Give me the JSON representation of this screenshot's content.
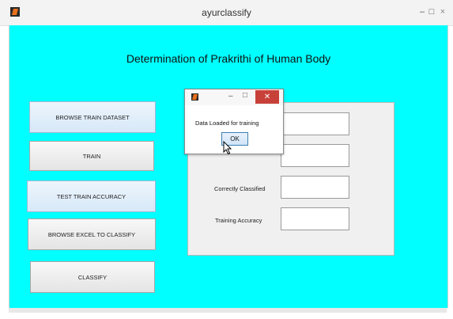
{
  "window": {
    "title": "ayurclassify",
    "min_glyph": "–",
    "max_glyph": "□",
    "close_glyph": "×"
  },
  "main": {
    "heading": "Determination of Prakrithi of Human Body",
    "buttons": {
      "browse_train": "BROWSE TRAIN DATASET",
      "train": "TRAIN",
      "test_accuracy": "TEST TRAIN ACCURACY",
      "browse_excel": "BROWSE EXCEL TO CLASSIFY",
      "classify": "CLASSIFY"
    },
    "panel": {
      "correctly_classified_label": "Correctly Classified",
      "training_accuracy_label": "Training Accuracy"
    }
  },
  "dialog": {
    "min_glyph": "–",
    "max_glyph": "□",
    "close_glyph": "✕",
    "message": "Data Loaded for training",
    "ok_label": "OK"
  },
  "colors": {
    "client_bg": "#00ffff",
    "close_red": "#c7413a"
  },
  "icons": [
    "app-icon",
    "minimize-icon",
    "maximize-icon",
    "close-icon",
    "mouse-cursor-icon"
  ]
}
